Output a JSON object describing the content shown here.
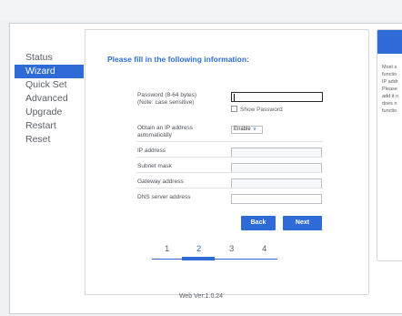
{
  "sidebar": {
    "items": [
      {
        "label": "Status"
      },
      {
        "label": "Wizard"
      },
      {
        "label": "Quick Set"
      },
      {
        "label": "Advanced"
      },
      {
        "label": "Upgrade"
      },
      {
        "label": "Restart"
      },
      {
        "label": "Reset"
      }
    ],
    "active": "Wizard"
  },
  "main": {
    "heading": "Please fill in the following information:",
    "password_label_1": "Password (8-64 bytes)",
    "password_label_2": "(Note: case sensitive)",
    "password_value": "",
    "show_password_label": "Show Password",
    "show_password_checked": false,
    "obtain_ip_label_1": "Obtain an IP address",
    "obtain_ip_label_2": "automatically",
    "obtain_ip_value": "Enable",
    "ip_address_label": "IP address",
    "subnet_mask_label": "Subnet mask",
    "gateway_label": "Gateway address",
    "dns_label": "DNS server address",
    "back_label": "Back",
    "next_label": "Next"
  },
  "steps": {
    "items": [
      "1",
      "2",
      "3",
      "4"
    ],
    "current": "2"
  },
  "help": {
    "lines": [
      "Most s",
      "functio",
      "IP addr",
      "Please",
      "add it n",
      "does n",
      "functio"
    ]
  },
  "footer": {
    "version": "Web Ver:1.0.24"
  },
  "colors": {
    "accent": "#2e6bd6",
    "text": "#5a5f66"
  }
}
